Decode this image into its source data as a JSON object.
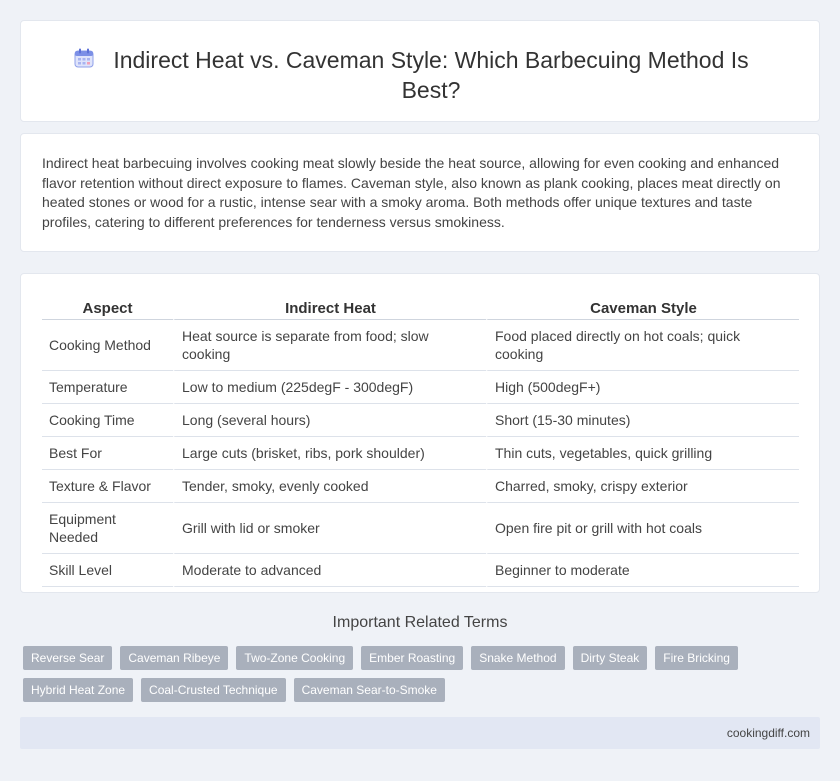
{
  "header": {
    "title": "Indirect Heat vs. Caveman Style: Which Barbecuing Method Is Best?",
    "icon": "calendar-icon"
  },
  "intro": {
    "text": "Indirect heat barbecuing involves cooking meat slowly beside the heat source, allowing for even cooking and enhanced flavor retention without direct exposure to flames. Caveman style, also known as plank cooking, places meat directly on heated stones or wood for a rustic, intense sear with a smoky aroma. Both methods offer unique textures and taste profiles, catering to different preferences for tenderness versus smokiness."
  },
  "table": {
    "headers": [
      "Aspect",
      "Indirect Heat",
      "Caveman Style"
    ],
    "rows": [
      [
        "Cooking Method",
        "Heat source is separate from food; slow cooking",
        "Food placed directly on hot coals; quick cooking"
      ],
      [
        "Temperature",
        "Low to medium (225degF - 300degF)",
        "High (500degF+)"
      ],
      [
        "Cooking Time",
        "Long (several hours)",
        "Short (15-30 minutes)"
      ],
      [
        "Best For",
        "Large cuts (brisket, ribs, pork shoulder)",
        "Thin cuts, vegetables, quick grilling"
      ],
      [
        "Texture & Flavor",
        "Tender, smoky, evenly cooked",
        "Charred, smoky, crispy exterior"
      ],
      [
        "Equipment Needed",
        "Grill with lid or smoker",
        "Open fire pit or grill with hot coals"
      ],
      [
        "Skill Level",
        "Moderate to advanced",
        "Beginner to moderate"
      ]
    ]
  },
  "related": {
    "title": "Important Related Terms",
    "tags": [
      "Reverse Sear",
      "Caveman Ribeye",
      "Two-Zone Cooking",
      "Ember Roasting",
      "Snake Method",
      "Dirty Steak",
      "Fire Bricking",
      "Hybrid Heat Zone",
      "Coal-Crusted Technique",
      "Caveman Sear-to-Smoke"
    ]
  },
  "footer": {
    "site": "cookingdiff.com"
  },
  "colors": {
    "background": "#eff2f7",
    "tag_bg": "#a9b0bc",
    "footer_bg": "#e2e7f3",
    "icon_accent": "#7b8fe6"
  }
}
